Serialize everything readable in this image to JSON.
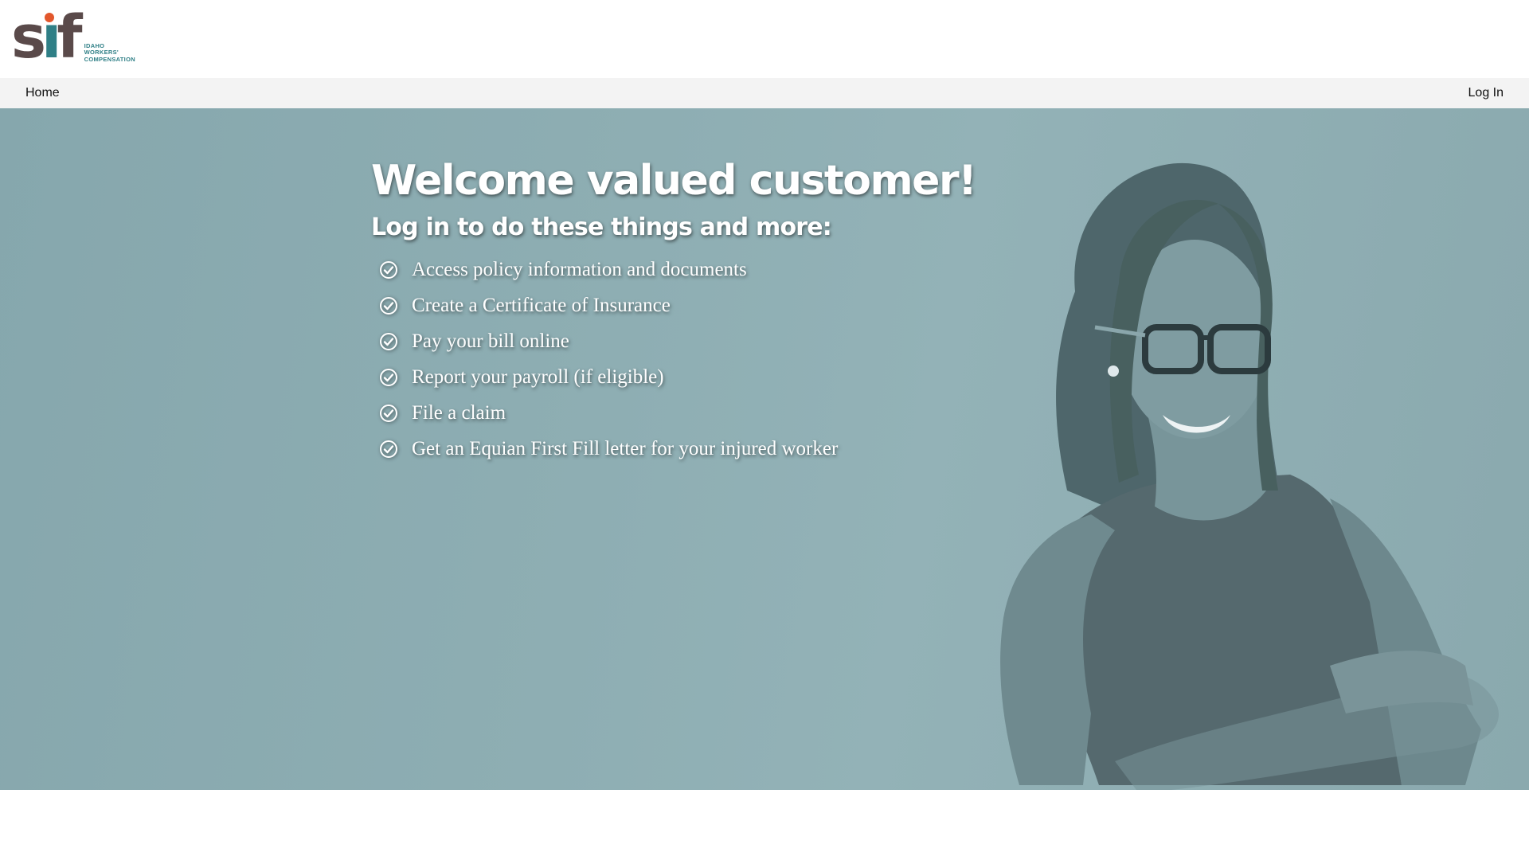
{
  "logo": {
    "word": "sif",
    "lines": [
      "IDAHO",
      "WORKERS'",
      "COMPENSATION"
    ]
  },
  "nav": {
    "home_label": "Home",
    "login_label": "Log In"
  },
  "hero": {
    "title": "Welcome valued customer!",
    "subtitle": "Log in to do these things and more:",
    "features": [
      "Access policy information and documents",
      "Create a Certificate of Insurance",
      "Pay your bill online",
      "Report your payroll (if eligible)",
      "File a claim",
      "Get an Equian First Fill letter for your injured worker"
    ]
  },
  "colors": {
    "hero_bg": "#8eaeb3",
    "logo_brown": "#5a4a4a",
    "logo_teal": "#2f7f86",
    "logo_orange": "#e2572c",
    "nav_bg": "#f3f3f3"
  },
  "icons": {
    "feature_bullet": "check-circle-icon"
  }
}
